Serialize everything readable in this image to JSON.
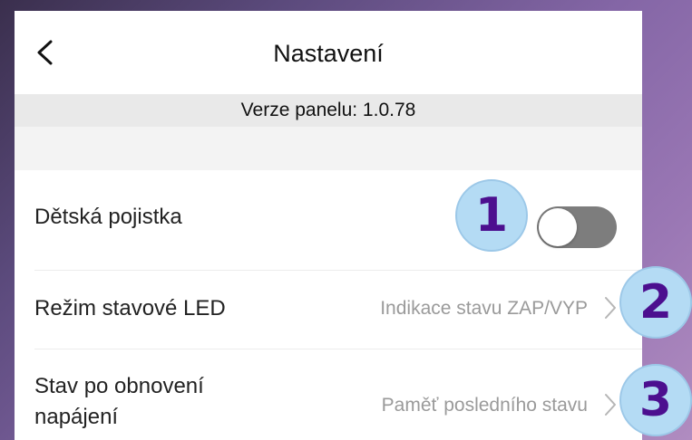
{
  "header": {
    "title": "Nastavení",
    "back_icon": "chevron-left-icon"
  },
  "version_text": "Verze panelu: 1.0.78",
  "settings": {
    "child_lock": {
      "label": "Dětská pojistka",
      "toggle_on": false
    },
    "led_mode": {
      "label": "Režim stavové LED",
      "value": "Indikace stavu ZAP/VYP"
    },
    "power_restore": {
      "label_line1": "Stav po obnovení",
      "label_line2": "napájení",
      "value": "Paměť posledního stavu"
    }
  },
  "callouts": [
    "1",
    "2",
    "3"
  ],
  "colors": {
    "callout_bg": "#b4dbf4",
    "callout_text": "#4c0f8f",
    "toggle_off": "#7d7d7d",
    "value_text": "#9a9a9a"
  }
}
